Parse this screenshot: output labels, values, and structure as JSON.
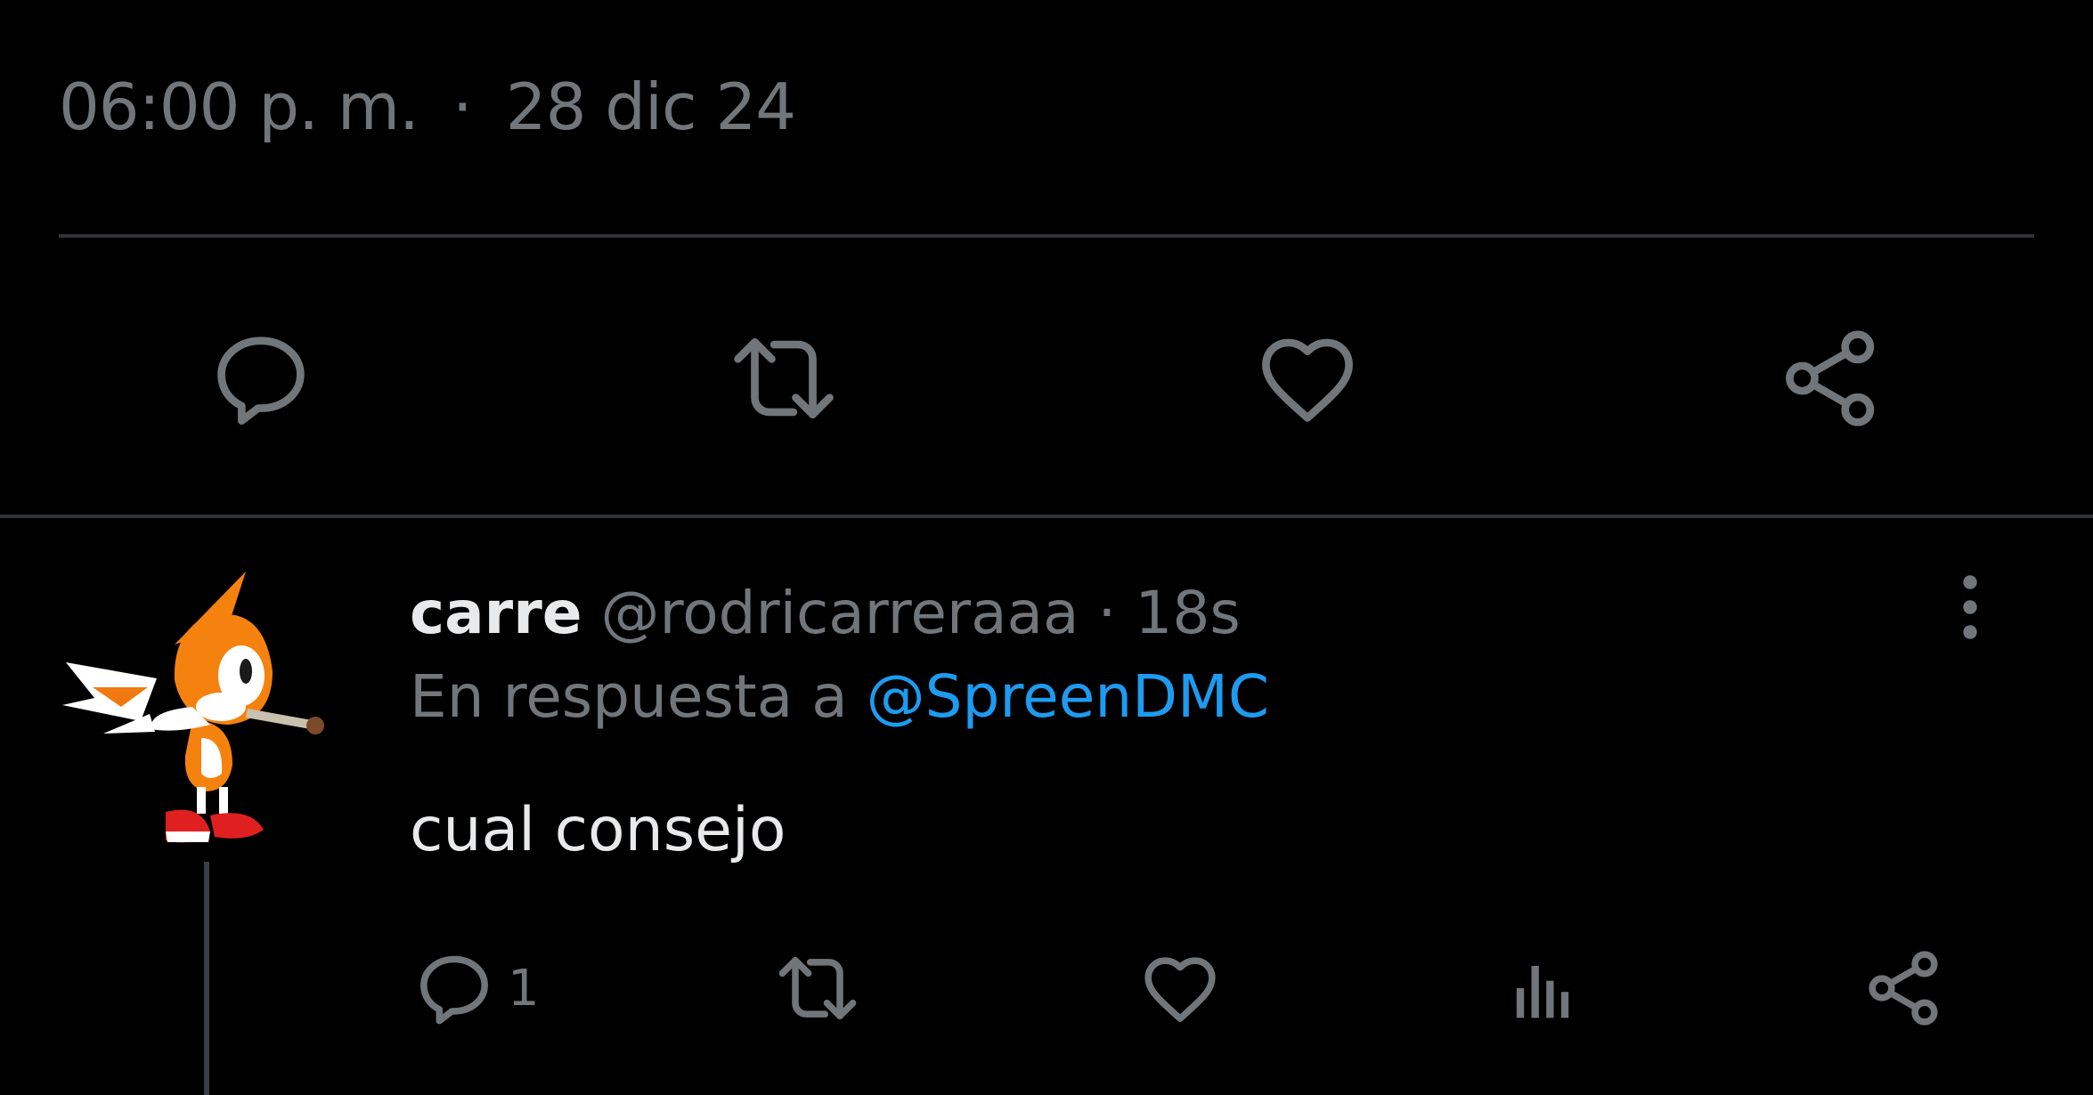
{
  "main_tweet": {
    "time": "06:00 p. m.",
    "separator": "·",
    "date": "28 dic 24",
    "actions": {
      "reply_icon": "reply-bubble-icon",
      "retweet_icon": "retweet-icon",
      "like_icon": "heart-icon",
      "share_icon": "share-icon"
    }
  },
  "reply": {
    "display_name": "carre",
    "handle": "@rodricarreraaa",
    "separator": "·",
    "age": "18s",
    "in_reply_prefix": "En respuesta a",
    "in_reply_to": "@SpreenDMC",
    "text": "cual consejo",
    "reply_count": "1",
    "avatar": "orange-fox-character-avatar"
  },
  "colors": {
    "background": "#000000",
    "muted": "#71767b",
    "text": "#e7e9ea",
    "link": "#1d9bf0",
    "divider": "#2f3336"
  }
}
